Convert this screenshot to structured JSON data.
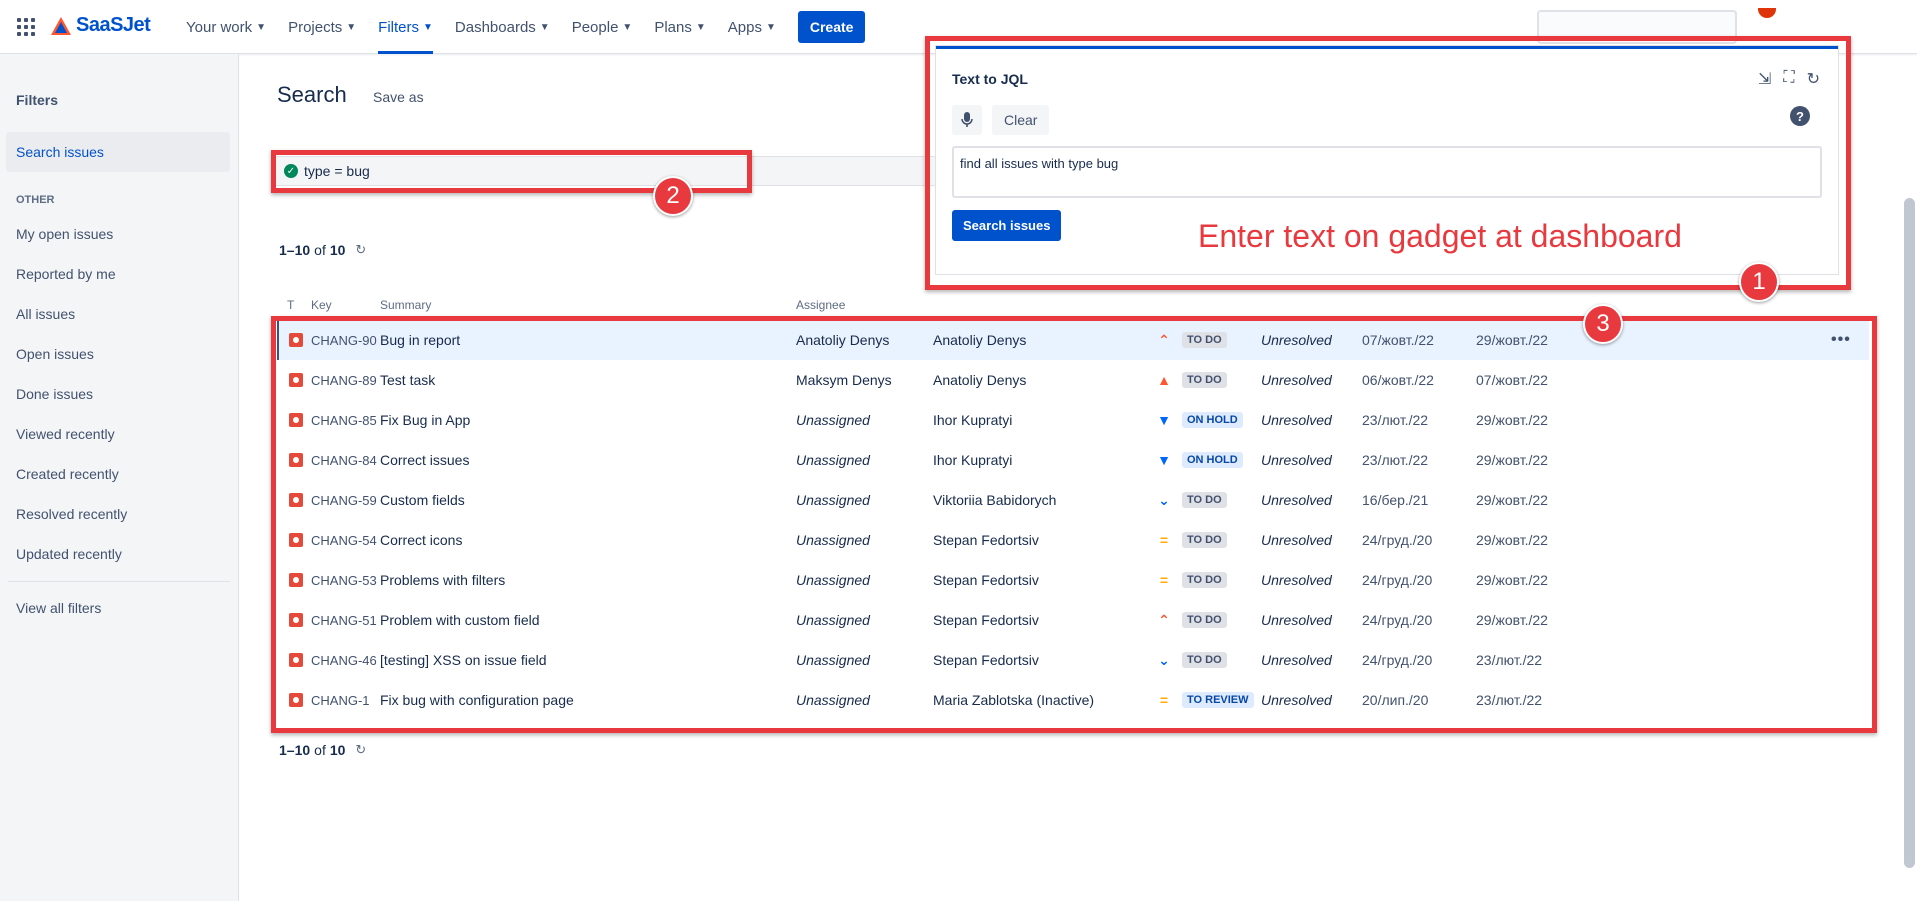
{
  "nav": {
    "logo": "SaaSJet",
    "items": [
      {
        "label": "Your work",
        "active": false
      },
      {
        "label": "Projects",
        "active": false
      },
      {
        "label": "Filters",
        "active": true
      },
      {
        "label": "Dashboards",
        "active": false
      },
      {
        "label": "People",
        "active": false
      },
      {
        "label": "Plans",
        "active": false
      },
      {
        "label": "Apps",
        "active": false
      }
    ],
    "create_label": "Create"
  },
  "sidebar": {
    "title": "Filters",
    "search_issues": "Search issues",
    "other_heading": "OTHER",
    "items": [
      "My open issues",
      "Reported by me",
      "All issues",
      "Open issues",
      "Done issues",
      "Viewed recently",
      "Created recently",
      "Resolved recently",
      "Updated recently"
    ],
    "view_all": "View all filters"
  },
  "main": {
    "title": "Search",
    "save_as": "Save as",
    "jql": "type = bug",
    "pager": {
      "range": "1–10",
      "of": "of",
      "total": "10"
    },
    "columns": {
      "t": "T",
      "key": "Key",
      "summary": "Summary",
      "assignee": "Assignee"
    }
  },
  "issues": [
    {
      "key": "CHANG-90",
      "summary": "Bug in report",
      "assignee": "Anatoliy Denys",
      "unassigned": false,
      "reporter": "Anatoliy Denys",
      "priority": "high",
      "status": "TO DO",
      "status_blue": false,
      "resolution": "Unresolved",
      "created": "07/жовт./22",
      "updated": "29/жовт./22"
    },
    {
      "key": "CHANG-89",
      "summary": "Test task",
      "assignee": "Maksym Denys",
      "unassigned": false,
      "reporter": "Anatoliy Denys",
      "priority": "highest",
      "status": "TO DO",
      "status_blue": false,
      "resolution": "Unresolved",
      "created": "06/жовт./22",
      "updated": "07/жовт./22"
    },
    {
      "key": "CHANG-85",
      "summary": "Fix Bug in App",
      "assignee": "Unassigned",
      "unassigned": true,
      "reporter": "Ihor Kupratyi",
      "priority": "lowest",
      "status": "ON HOLD",
      "status_blue": true,
      "resolution": "Unresolved",
      "created": "23/лют./22",
      "updated": "29/жовт./22"
    },
    {
      "key": "CHANG-84",
      "summary": "Correct issues",
      "assignee": "Unassigned",
      "unassigned": true,
      "reporter": "Ihor Kupratyi",
      "priority": "lowest",
      "status": "ON HOLD",
      "status_blue": true,
      "resolution": "Unresolved",
      "created": "23/лют./22",
      "updated": "29/жовт./22"
    },
    {
      "key": "CHANG-59",
      "summary": "Custom fields",
      "assignee": "Unassigned",
      "unassigned": true,
      "reporter": "Viktoriia Babidorych",
      "priority": "low",
      "status": "TO DO",
      "status_blue": false,
      "resolution": "Unresolved",
      "created": "16/бер./21",
      "updated": "29/жовт./22"
    },
    {
      "key": "CHANG-54",
      "summary": "Correct icons",
      "assignee": "Unassigned",
      "unassigned": true,
      "reporter": "Stepan Fedortsiv",
      "priority": "medium",
      "status": "TO DO",
      "status_blue": false,
      "resolution": "Unresolved",
      "created": "24/груд./20",
      "updated": "29/жовт./22"
    },
    {
      "key": "CHANG-53",
      "summary": "Problems with filters",
      "assignee": "Unassigned",
      "unassigned": true,
      "reporter": "Stepan Fedortsiv",
      "priority": "medium",
      "status": "TO DO",
      "status_blue": false,
      "resolution": "Unresolved",
      "created": "24/груд./20",
      "updated": "29/жовт./22"
    },
    {
      "key": "CHANG-51",
      "summary": "Problem with custom field",
      "assignee": "Unassigned",
      "unassigned": true,
      "reporter": "Stepan Fedortsiv",
      "priority": "high",
      "status": "TO DO",
      "status_blue": false,
      "resolution": "Unresolved",
      "created": "24/груд./20",
      "updated": "29/жовт./22"
    },
    {
      "key": "CHANG-46",
      "summary": "[testing] XSS on issue field",
      "assignee": "Unassigned",
      "unassigned": true,
      "reporter": "Stepan Fedortsiv",
      "priority": "low",
      "status": "TO DO",
      "status_blue": false,
      "resolution": "Unresolved",
      "created": "24/груд./20",
      "updated": "23/лют./22"
    },
    {
      "key": "CHANG-1",
      "summary": "Fix bug with configuration page",
      "assignee": "Unassigned",
      "unassigned": true,
      "reporter": "Maria Zablotska (Inactive)",
      "priority": "medium",
      "status": "TO REVIEW",
      "status_blue": true,
      "resolution": "Unresolved",
      "created": "20/лип./20",
      "updated": "23/лют./22"
    }
  ],
  "gadget": {
    "title": "Text to JQL",
    "clear_label": "Clear",
    "help": "?",
    "query": "find all issues with type bug",
    "search_label": "Search issues"
  },
  "annotations": {
    "caption": "Enter text on gadget at dashboard",
    "markers": [
      "1",
      "2",
      "3"
    ]
  },
  "colors": {
    "accent": "#0052cc",
    "annotation": "#e8393e",
    "bug": "#e5493a",
    "priority_high": "#ff5630",
    "priority_medium": "#ffab00",
    "priority_low": "#0065ff"
  }
}
